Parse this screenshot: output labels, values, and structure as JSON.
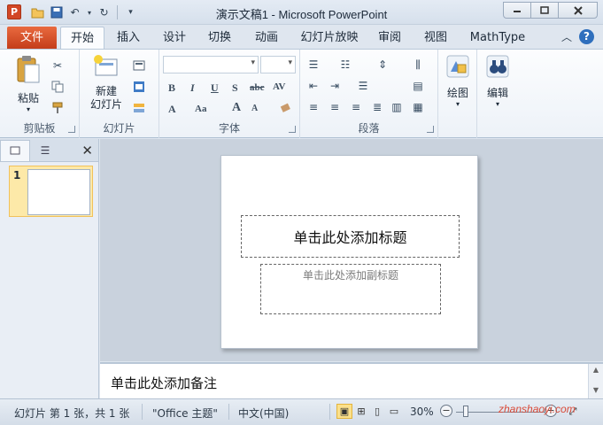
{
  "app": {
    "window_title": "演示文稿1 - Microsoft PowerPoint",
    "app_letter": "P"
  },
  "quick_access": {
    "icons": [
      "open-folder-icon",
      "save-icon",
      "undo-icon",
      "redo-icon",
      "customize-qat-icon"
    ]
  },
  "tabs": {
    "file": "文件",
    "items": [
      "开始",
      "插入",
      "设计",
      "切换",
      "动画",
      "幻灯片放映",
      "审阅",
      "视图",
      "MathType"
    ],
    "active_index": 0
  },
  "ribbon": {
    "clipboard": {
      "paste_label": "粘贴",
      "group_label": "剪贴板"
    },
    "slides": {
      "new_slide_label": "新建\n幻灯片",
      "group_label": "幻灯片"
    },
    "font": {
      "group_label": "字体",
      "bold": "B",
      "italic": "I",
      "underline": "U",
      "shadow": "S",
      "strike": "abc",
      "spacing": "AV",
      "grow": "A",
      "shrink": "A",
      "color": "A",
      "case": "Aa"
    },
    "paragraph": {
      "group_label": "段落"
    },
    "drawing": {
      "label": "绘图"
    },
    "editing": {
      "label": "编辑"
    }
  },
  "left_pane": {
    "slide_number": "1"
  },
  "slide": {
    "title_placeholder": "单击此处添加标题",
    "subtitle_placeholder": "单击此处添加副标题"
  },
  "notes": {
    "placeholder": "单击此处添加备注"
  },
  "status": {
    "slide_info": "幻灯片 第 1 张，共 1 张",
    "theme": "\"Office 主题\"",
    "language": "中文(中国)",
    "zoom": "30%"
  },
  "watermark": "zhanshaoyi.com",
  "colors": {
    "file_tab": "#d04a23",
    "accent_blue": "#2f6fbd",
    "selected_thumb": "#fde9a8"
  }
}
